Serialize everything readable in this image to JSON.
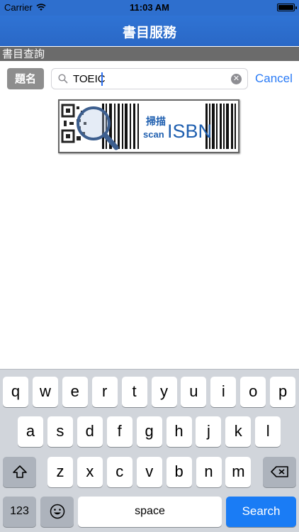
{
  "status_bar": {
    "carrier": "Carrier",
    "time": "11:03 AM",
    "wifi_icon": "wifi-icon",
    "battery_icon": "battery-icon"
  },
  "nav": {
    "title": "書目服務"
  },
  "section": {
    "header": "書目查詢"
  },
  "search": {
    "scope_label": "題名",
    "value": "TOEIC",
    "cancel_label": "Cancel"
  },
  "banner": {
    "label_chinese": "掃描",
    "label_scan": "scan",
    "label_isbn": "ISBN"
  },
  "keyboard": {
    "row1": [
      "q",
      "w",
      "e",
      "r",
      "t",
      "y",
      "u",
      "i",
      "o",
      "p"
    ],
    "row2": [
      "a",
      "s",
      "d",
      "f",
      "g",
      "h",
      "j",
      "k",
      "l"
    ],
    "row3": [
      "z",
      "x",
      "c",
      "v",
      "b",
      "n",
      "m"
    ],
    "numbers_label": "123",
    "space_label": "space",
    "search_label": "Search",
    "shift_icon": "shift-icon",
    "emoji_icon": "emoji-icon",
    "backspace_icon": "backspace-icon"
  },
  "colors": {
    "nav_blue": "#2f73d4",
    "section_gray": "#6b6b6b",
    "accent_blue": "#2a7bf6",
    "search_key_blue": "#1a7cf5"
  }
}
